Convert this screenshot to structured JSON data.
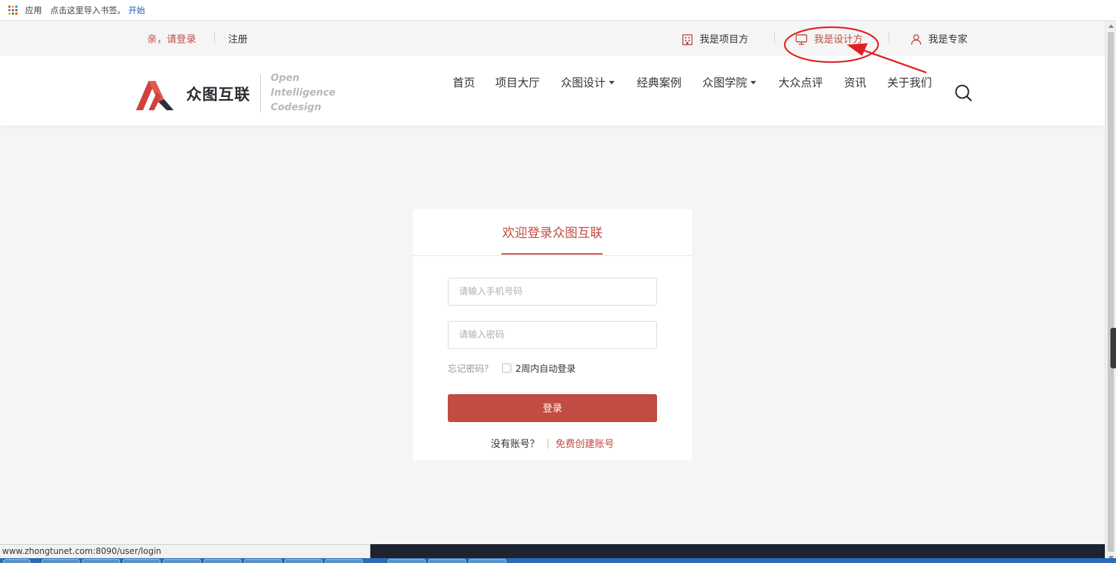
{
  "bookmarks": {
    "apps_label": "应用",
    "hint": "点击这里导入书签。",
    "start_link": "开始"
  },
  "topbar": {
    "login_prompt": "亲，请登录",
    "register": "注册",
    "roles": [
      {
        "label": "我是项目方",
        "icon": "building-icon"
      },
      {
        "label": "我是设计方",
        "icon": "monitor-icon"
      },
      {
        "label": "我是专家",
        "icon": "person-icon"
      }
    ]
  },
  "header": {
    "logo_name": "众图互联",
    "logo_tagline": [
      "Open",
      "Intelligence",
      "Codesign"
    ],
    "nav": [
      "首页",
      "项目大厅",
      "众图设计",
      "经典案例",
      "众图学院",
      "大众点评",
      "资讯",
      "关于我们"
    ]
  },
  "login": {
    "title": "欢迎登录众图互联",
    "phone_placeholder": "请输入手机号码",
    "password_placeholder": "请输入密码",
    "forgot": "忘记密码？",
    "auto_login": "2周内自动登录",
    "submit": "登录",
    "no_account": "没有账号？",
    "create_account": "免费创建账号"
  },
  "status_bar": {
    "url": "www.zhongtunet.com:8090/user/login"
  },
  "colors": {
    "brand": "#c14c42",
    "annotation": "#e02020"
  }
}
